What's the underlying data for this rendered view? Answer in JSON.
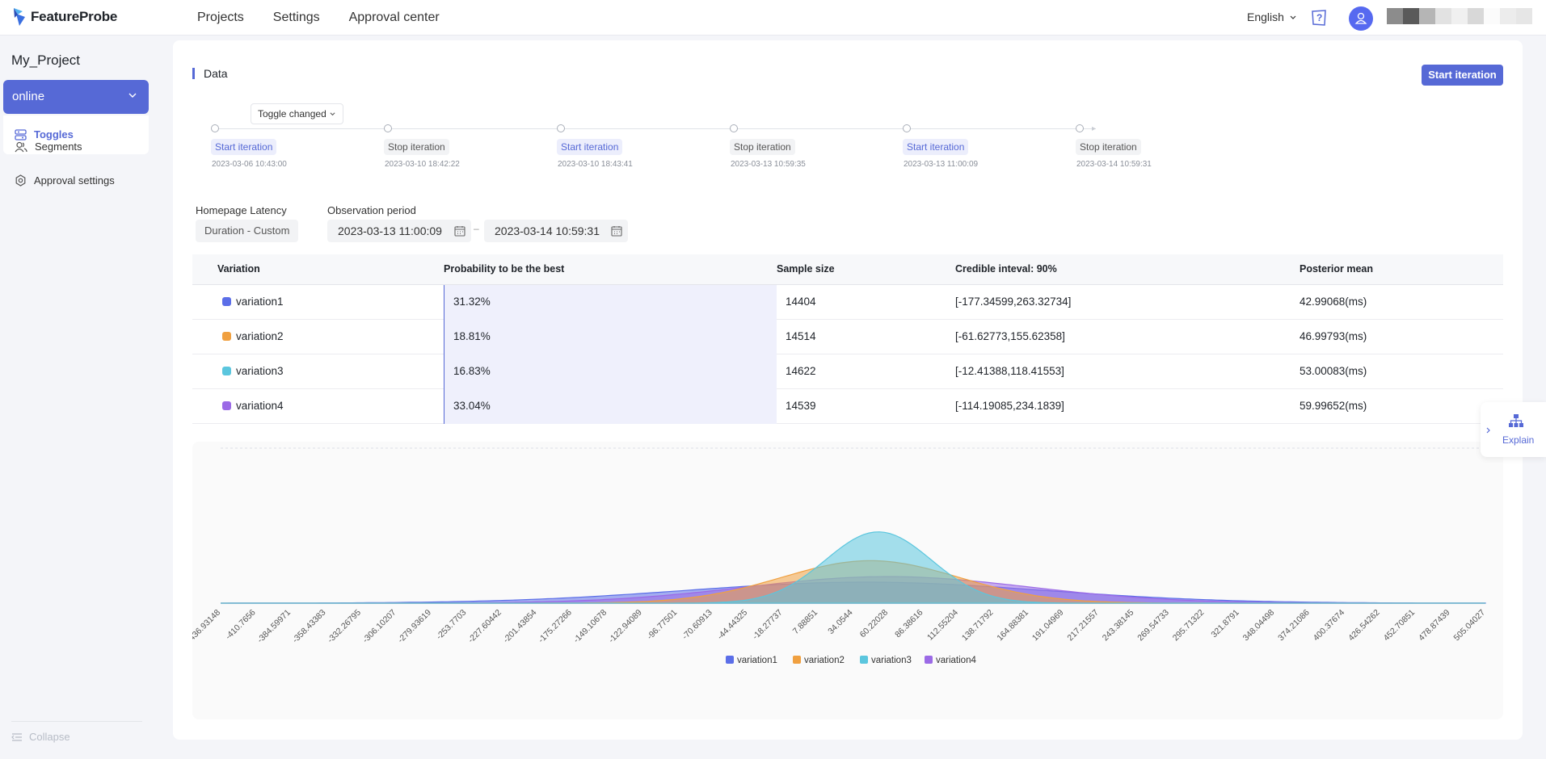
{
  "app": {
    "logo_text": "FeatureProbe"
  },
  "nav": {
    "projects": "Projects",
    "settings": "Settings",
    "approval_center": "Approval center"
  },
  "header": {
    "language": "English"
  },
  "sidebar": {
    "project_name": "My_Project",
    "environment": "online",
    "items": [
      {
        "label": "Toggles"
      },
      {
        "label": "Segments"
      },
      {
        "label": "Approval settings"
      }
    ],
    "collapse": "Collapse"
  },
  "data_section": {
    "title": "Data",
    "start_button": "Start iteration",
    "filter": "Toggle changed",
    "timeline": [
      {
        "label": "Start iteration",
        "time": "2023-03-06 10:43:00",
        "kind": "start"
      },
      {
        "label": "Stop iteration",
        "time": "2023-03-10 18:42:22",
        "kind": "stop"
      },
      {
        "label": "Start iteration",
        "time": "2023-03-10 18:43:41",
        "kind": "start"
      },
      {
        "label": "Stop iteration",
        "time": "2023-03-13 10:59:35",
        "kind": "stop"
      },
      {
        "label": "Start iteration",
        "time": "2023-03-13 11:00:09",
        "kind": "start"
      },
      {
        "label": "Stop iteration",
        "time": "2023-03-14 10:59:31",
        "kind": "stop"
      }
    ],
    "metric_name": "Homepage Latency",
    "metric_type": "Duration - Custom",
    "observation_label": "Observation period",
    "date_start": "2023-03-13 11:00:09",
    "date_end": "2023-03-14 10:59:31"
  },
  "table": {
    "headers": {
      "variation": "Variation",
      "probability": "Probability to be the best",
      "sample": "Sample size",
      "credible": "Credible inteval: 90%",
      "posterior": "Posterior mean"
    },
    "rows": [
      {
        "name": "variation1",
        "prob": "31.32%",
        "sample": "14404",
        "credible": "[-177.34599,263.32734]",
        "mean": "42.99068(ms)"
      },
      {
        "name": "variation2",
        "prob": "18.81%",
        "sample": "14514",
        "credible": "[-61.62773,155.62358]",
        "mean": "46.99793(ms)"
      },
      {
        "name": "variation3",
        "prob": "16.83%",
        "sample": "14622",
        "credible": "[-12.41388,118.41553]",
        "mean": "53.00083(ms)"
      },
      {
        "name": "variation4",
        "prob": "33.04%",
        "sample": "14539",
        "credible": "[-114.19085,234.1839]",
        "mean": "59.99652(ms)"
      }
    ]
  },
  "colors": {
    "accent": "#5669d6",
    "variation1": "#5b6ee8",
    "variation2": "#f0a040",
    "variation3": "#5bc6de",
    "variation4": "#9b6ae6"
  },
  "chart_data": {
    "type": "area",
    "x_tick_labels": [
      "-436.93148",
      "-410.7656",
      "-384.59971",
      "-358.43383",
      "-332.26795",
      "-306.10207",
      "-279.93619",
      "-253.7703",
      "-227.60442",
      "-201.43854",
      "-175.27266",
      "-149.10678",
      "-122.94089",
      "-96.77501",
      "-70.60913",
      "-44.44325",
      "-18.27737",
      "7.88851",
      "34.0544",
      "60.22028",
      "86.38616",
      "112.55204",
      "138.71792",
      "164.88381",
      "191.04969",
      "217.21557",
      "243.38145",
      "269.54733",
      "295.71322",
      "321.8791",
      "348.04498",
      "374.21086",
      "400.37674",
      "426.54262",
      "452.70851",
      "478.87439",
      "505.04027"
    ],
    "xlim": [
      -436.93148,
      505.04027
    ],
    "ylim": [
      0,
      0.022
    ],
    "series": [
      {
        "name": "variation1",
        "mean": 42.99068,
        "sd": 133.9,
        "peak": 0.00298
      },
      {
        "name": "variation2",
        "mean": 46.99793,
        "sd": 66.1,
        "peak": 0.00603
      },
      {
        "name": "variation3",
        "mean": 53.00083,
        "sd": 39.4,
        "peak": 0.01012
      },
      {
        "name": "variation4",
        "mean": 59.99652,
        "sd": 105.8,
        "peak": 0.00377
      }
    ],
    "legend": [
      "variation1",
      "variation2",
      "variation3",
      "variation4"
    ],
    "legend_position": "bottom",
    "grid": false
  },
  "explain": {
    "label": "Explain"
  }
}
